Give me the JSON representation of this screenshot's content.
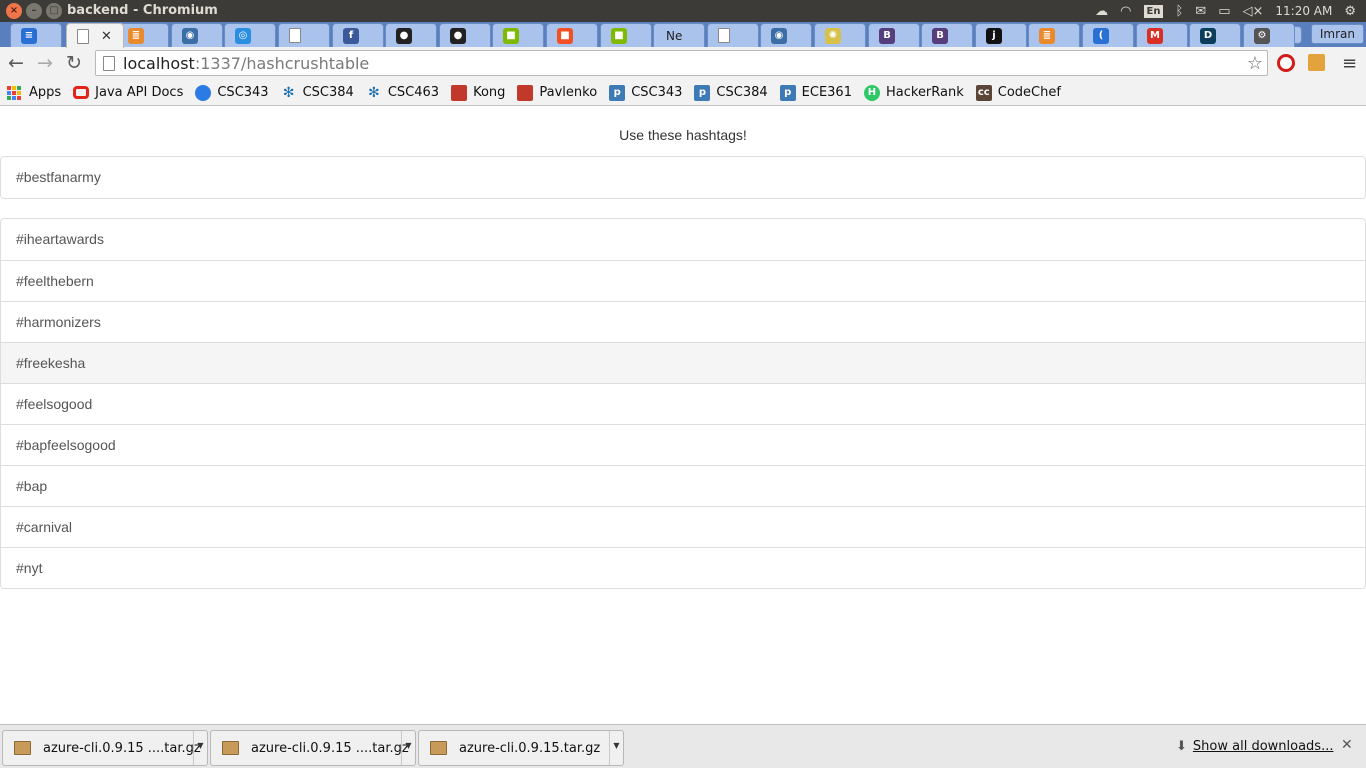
{
  "window": {
    "title": "backend - Chromium",
    "tray": {
      "lang": "En",
      "time": "11:20 AM"
    }
  },
  "tabs": {
    "profile": "Imran",
    "items": [
      {
        "label": "",
        "icon": "docs-icon",
        "color": "#2a6fd6",
        "glyph": "≡"
      },
      {
        "label": "",
        "icon": "page-icon",
        "color": "#ffffff",
        "glyph": "",
        "active": true
      },
      {
        "label": "",
        "icon": "stackoverflow-icon",
        "color": "#e98a2d",
        "glyph": "≣"
      },
      {
        "label": "",
        "icon": "python-icon",
        "color": "#3b6ea5",
        "glyph": "◉"
      },
      {
        "label": "",
        "icon": "globe-icon",
        "color": "#2a8fe0",
        "glyph": "◎"
      },
      {
        "label": "",
        "icon": "page-icon",
        "color": "#ffffff",
        "glyph": ""
      },
      {
        "label": "",
        "icon": "facebook-icon",
        "color": "#3b5998",
        "glyph": "f"
      },
      {
        "label": "",
        "icon": "github-icon",
        "color": "#222222",
        "glyph": "●"
      },
      {
        "label": "",
        "icon": "github-icon",
        "color": "#222222",
        "glyph": "●"
      },
      {
        "label": "",
        "icon": "microsoft-icon",
        "color": "#7fba00",
        "glyph": "■"
      },
      {
        "label": "",
        "icon": "microsoft-icon",
        "color": "#f25022",
        "glyph": "■"
      },
      {
        "label": "",
        "icon": "microsoft-icon",
        "color": "#7fba00",
        "glyph": "■"
      },
      {
        "label": "Ne",
        "icon": "text-tab-icon",
        "color": "#a9c3ec",
        "glyph": ""
      },
      {
        "label": "",
        "icon": "page-icon",
        "color": "#ffffff",
        "glyph": ""
      },
      {
        "label": "",
        "icon": "python-icon",
        "color": "#3b6ea5",
        "glyph": "◉"
      },
      {
        "label": "",
        "icon": "sun-icon",
        "color": "#d6c24a",
        "glyph": "✺"
      },
      {
        "label": "",
        "icon": "bootstrap-icon",
        "color": "#563d7c",
        "glyph": "B"
      },
      {
        "label": "",
        "icon": "bootstrap-icon",
        "color": "#563d7c",
        "glyph": "B"
      },
      {
        "label": "",
        "icon": "jsfiddle-icon",
        "color": "#111111",
        "glyph": "j"
      },
      {
        "label": "",
        "icon": "stackoverflow-icon",
        "color": "#e98a2d",
        "glyph": "≣"
      },
      {
        "label": "",
        "icon": "wave-icon",
        "color": "#2a6fd6",
        "glyph": "("
      },
      {
        "label": "",
        "icon": "gmail-icon",
        "color": "#d93025",
        "glyph": "M"
      },
      {
        "label": "",
        "icon": "d-icon",
        "color": "#0b3d5c",
        "glyph": "D"
      },
      {
        "label": "",
        "icon": "settings-icon",
        "color": "#555555",
        "glyph": "⚙"
      }
    ]
  },
  "toolbar": {
    "url_host": "localhost",
    "url_rest": ":1337/hashcrushtable"
  },
  "bookmarks": [
    {
      "label": "Apps",
      "icon": "apps-icon",
      "color": ""
    },
    {
      "label": "Java API Docs",
      "icon": "oracle-icon",
      "color": "#e2231a"
    },
    {
      "label": "CSC343",
      "icon": "circle-icon",
      "color": "#2a7be4"
    },
    {
      "label": "CSC384",
      "icon": "snowflake-icon",
      "color": "#1a6fb0"
    },
    {
      "label": "CSC463",
      "icon": "snowflake-icon",
      "color": "#1a6fb0"
    },
    {
      "label": "Kong",
      "icon": "crest-icon",
      "color": "#c0392b"
    },
    {
      "label": "Pavlenko",
      "icon": "crest-icon",
      "color": "#c0392b"
    },
    {
      "label": "CSC343",
      "icon": "piazza-icon",
      "color": "#3e7ab5"
    },
    {
      "label": "CSC384",
      "icon": "piazza-icon",
      "color": "#3e7ab5"
    },
    {
      "label": "ECE361",
      "icon": "piazza-icon",
      "color": "#3e7ab5"
    },
    {
      "label": "HackerRank",
      "icon": "hackerrank-icon",
      "color": "#2ec866"
    },
    {
      "label": "CodeChef",
      "icon": "codechef-icon",
      "color": "#5b4638"
    }
  ],
  "main": {
    "heading": "Use these hashtags!",
    "top_tag": "#bestfanarmy",
    "tags": [
      {
        "label": "#iheartawards",
        "hover": false
      },
      {
        "label": "#feelthebern",
        "hover": false
      },
      {
        "label": "#harmonizers",
        "hover": false
      },
      {
        "label": "#freekesha",
        "hover": true
      },
      {
        "label": "#feelsogood",
        "hover": false
      },
      {
        "label": "#bapfeelsogood",
        "hover": false
      },
      {
        "label": "#bap",
        "hover": false
      },
      {
        "label": "#carnival",
        "hover": false
      },
      {
        "label": "#nyt",
        "hover": false
      }
    ]
  },
  "downloads": {
    "items": [
      {
        "label": "azure-cli.0.9.15 ....tar.gz"
      },
      {
        "label": "azure-cli.0.9.15 ....tar.gz"
      },
      {
        "label": "azure-cli.0.9.15.tar.gz"
      }
    ],
    "show_all": "Show all downloads..."
  }
}
